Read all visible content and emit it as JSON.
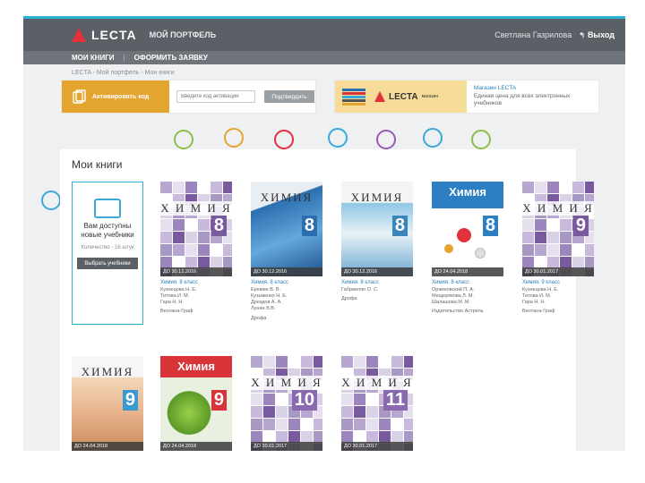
{
  "header": {
    "logo_text": "LECTA",
    "portfolio_label": "МОЙ ПОРТФЕЛЬ",
    "user_name": "Светлана Газрилова",
    "logout_label": "Выход"
  },
  "nav": {
    "items": [
      {
        "label": "МОИ КНИГИ"
      },
      {
        "label": "ОФОРМИТЬ ЗАЯВКУ"
      }
    ],
    "separator": "|"
  },
  "breadcrumb": "LECTA - Мой портфель - Мои книги",
  "activation": {
    "label": "Активировать код",
    "input_placeholder": "Введите код активации",
    "button_label": "Подтвердить"
  },
  "shop_banner": {
    "logo_text": "LECTA",
    "tag": "магазин",
    "title": "Магазин LECTA",
    "subtitle": "Единая цена для всех электронных учебников"
  },
  "main": {
    "title": "Мои книги",
    "promo": {
      "title": "Вам доступны новые учебники",
      "note": "Количество - 16 штук",
      "button_label": "Выбрать учебники"
    },
    "books": [
      {
        "cover_title": "Х И М И Я",
        "grade": "8",
        "until": "ДО 30.12.2016",
        "title": "Химия. 8 класс",
        "authors": [
          "Кузнецова Н. Е.",
          "Титова И. М.",
          "Гара Н. Н."
        ],
        "publisher": "Вентана-Граф",
        "style": "tiles",
        "accent": "#7a5a9e"
      },
      {
        "cover_title": "ХИМИЯ",
        "grade": "8",
        "until": "ДО 30.12.2016",
        "title": "Химия. 8 класс",
        "authors": [
          "Еремин В. В.",
          "Кузьменко Н. Е.",
          "Дроздов А. А.",
          "Лунин В.В."
        ],
        "publisher": "Дрофа",
        "style": "blue",
        "accent": "#2b6fb0"
      },
      {
        "cover_title": "ХИМИЯ",
        "grade": "8",
        "until": "ДО 30.12.2016",
        "title": "Химия. 8 класс",
        "authors": [
          "Габриелян О. С."
        ],
        "publisher": "Дрофа",
        "style": "flask",
        "accent": "#3a86b8"
      },
      {
        "cover_title": "Химия",
        "grade": "8",
        "until": "ДО 24.04.2018",
        "title": "Химия. 8 класс",
        "authors": [
          "Оржековский П. А.",
          "Мещерякова Л. М.",
          "Шалашова М. М."
        ],
        "publisher": "Издательство Астрель",
        "style": "molecule",
        "accent": "#2d7fc4"
      },
      {
        "cover_title": "Х И М И Я",
        "grade": "9",
        "until": "ДО 30.01.2017",
        "title": "Химия. 9 класс",
        "authors": [
          "Кузнецова Н. Е.",
          "Титова И. М.",
          "Гара Н. Н."
        ],
        "publisher": "Вентана-Граф",
        "style": "tiles",
        "accent": "#7a5a9e"
      },
      {
        "cover_title": "ХИМИЯ",
        "grade": "9",
        "until": "ДО 24.04.2018",
        "style": "glass",
        "accent": "#3a9ad0"
      },
      {
        "cover_title": "Химия",
        "grade": "9",
        "until": "ДО 24.04.2018",
        "style": "spheres",
        "accent": "#d8343a"
      },
      {
        "cover_title": "Х И М И Я",
        "grade": "10",
        "until": "ДО 30.01.2017",
        "style": "tiles",
        "accent": "#8a6aae"
      },
      {
        "cover_title": "Х И М И Я",
        "grade": "11",
        "until": "ДО 30.01.2017",
        "style": "tiles",
        "accent": "#8a6aae"
      }
    ]
  },
  "colors": {
    "topbar": "#5a6066",
    "activation": "#e3a530",
    "accent_blue": "#3aa9d8",
    "brand_red": "#e2313a"
  }
}
